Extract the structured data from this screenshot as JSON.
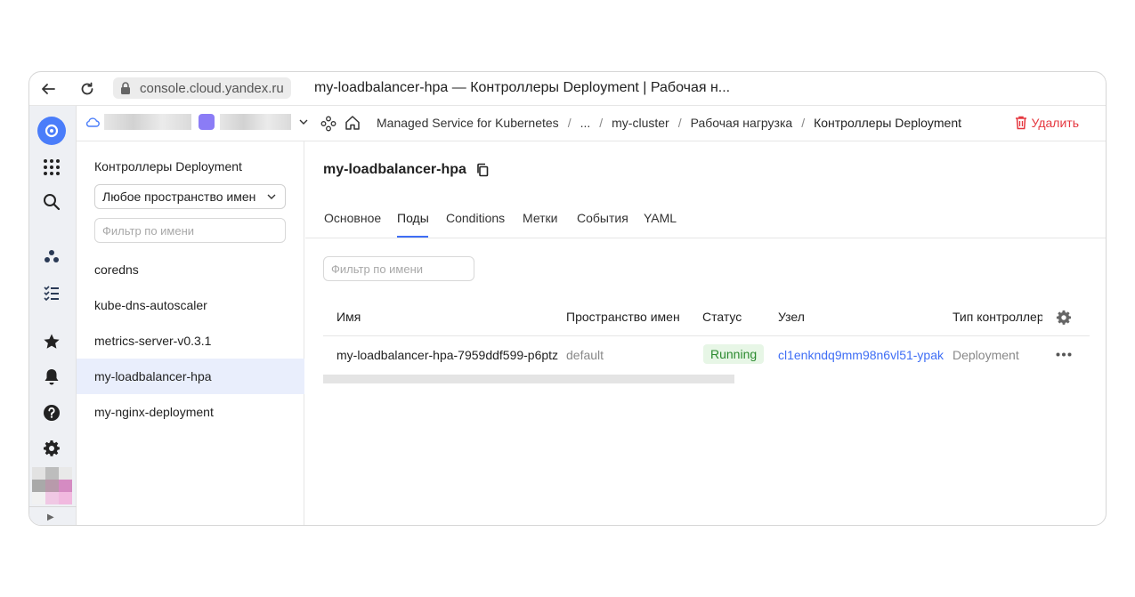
{
  "browser": {
    "url": "console.cloud.yandex.ru",
    "title": "my-loadbalancer-hpa — Контроллеры Deployment | Рабочая н..."
  },
  "header": {
    "breadcrumbs": [
      "Managed Service for Kubernetes",
      "...",
      "my-cluster",
      "Рабочая нагрузка",
      "Контроллеры Deployment"
    ],
    "delete_label": "Удалить"
  },
  "list_panel": {
    "title": "Контроллеры Deployment",
    "namespace_select": "Любое пространство имен",
    "filter_placeholder": "Фильтр по имени",
    "items": [
      {
        "label": "coredns"
      },
      {
        "label": "kube-dns-autoscaler"
      },
      {
        "label": "metrics-server-v0.3.1"
      },
      {
        "label": "my-loadbalancer-hpa"
      },
      {
        "label": "my-nginx-deployment"
      }
    ],
    "active_index": 3
  },
  "main": {
    "title": "my-loadbalancer-hpa",
    "tabs": [
      "Основное",
      "Поды",
      "Conditions",
      "Метки",
      "События",
      "YAML"
    ],
    "active_tab": "Поды",
    "filter_placeholder": "Фильтр по имени",
    "table": {
      "headers": [
        "Имя",
        "Пространство имен",
        "Статус",
        "Узел",
        "Тип контроллера"
      ],
      "rows": [
        {
          "name": "my-loadbalancer-hpa-7959ddf599-p6ptz",
          "namespace": "default",
          "status": "Running",
          "node": "cl1enkndq9mm98n6vl51-ypak",
          "controller_type": "Deployment"
        }
      ]
    }
  },
  "colors": {
    "accent": "#3f6ef5",
    "danger": "#e5373f",
    "running_bg": "#e7f6e6",
    "running_text": "#2b8a2f"
  }
}
